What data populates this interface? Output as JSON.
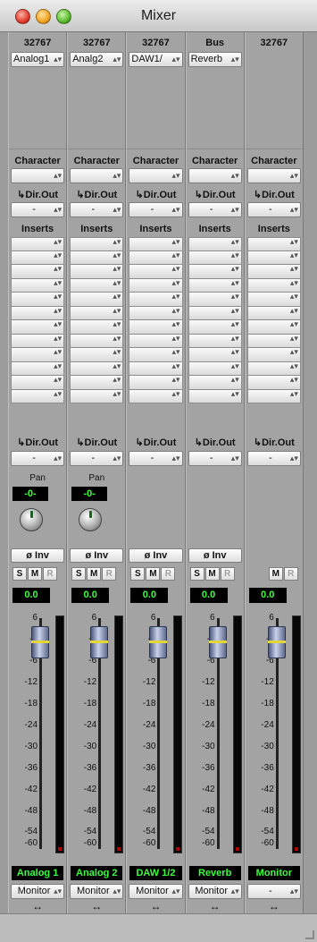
{
  "window": {
    "title": "Mixer"
  },
  "section_labels": {
    "character": "Character",
    "dir_out": "↳Dir.Out",
    "inserts": "Inserts",
    "pan": "Pan",
    "phase_inv": "ø Inv",
    "solo": "S",
    "mute": "M",
    "rec": "R"
  },
  "fader_scale": [
    "6",
    "-0",
    "-6",
    "-12",
    "-18",
    "-24",
    "-30",
    "-36",
    "-42",
    "-48",
    "-54",
    "-60"
  ],
  "strips": [
    {
      "channel": "32767",
      "input": "Analog1",
      "dir_out_top": "-",
      "dir_out_bottom": "-",
      "pan_value": "-0-",
      "gain": "0.0",
      "name": "Analog 1",
      "output": "Monitor"
    },
    {
      "channel": "32767",
      "input": "Analg2",
      "dir_out_top": "-",
      "dir_out_bottom": "-",
      "pan_value": "-0-",
      "gain": "0.0",
      "name": "Analog 2",
      "output": "Monitor"
    },
    {
      "channel": "32767",
      "input": "DAW1/",
      "dir_out_top": "-",
      "dir_out_bottom": "-",
      "gain": "0.0",
      "name": "DAW 1/2",
      "output": "Monitor"
    },
    {
      "channel": "Bus",
      "input": "Reverb",
      "dir_out_top": "-",
      "dir_out_bottom": "-",
      "gain": "0.0",
      "name": "Reverb",
      "output": "Monitor"
    },
    {
      "channel": "32767",
      "dir_out_top": "-",
      "dir_out_bottom": "-",
      "gain": "0.0",
      "name": "Monitor",
      "output": "-"
    }
  ],
  "icons": {
    "close": "close-light",
    "minimize": "minimize-light",
    "zoom": "zoom-light",
    "width_toggle": "double-arrow"
  },
  "colors": {
    "readout_text": "#3cff3c",
    "fader_cap": "#8e9ab8",
    "fader_line": "#e4d636"
  }
}
